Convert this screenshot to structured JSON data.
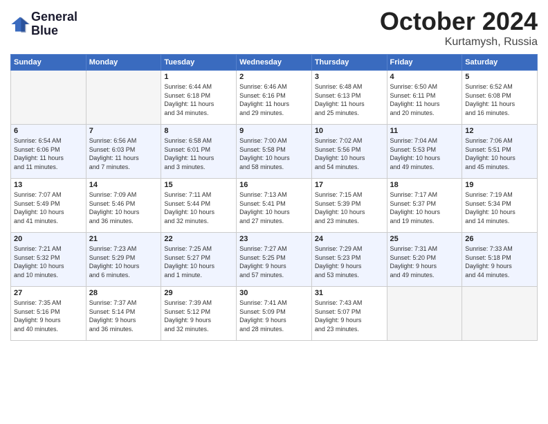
{
  "logo": {
    "line1": "General",
    "line2": "Blue"
  },
  "title": "October 2024",
  "location": "Kurtamysh, Russia",
  "weekdays": [
    "Sunday",
    "Monday",
    "Tuesday",
    "Wednesday",
    "Thursday",
    "Friday",
    "Saturday"
  ],
  "weeks": [
    [
      {
        "day": "",
        "info": ""
      },
      {
        "day": "",
        "info": ""
      },
      {
        "day": "1",
        "info": "Sunrise: 6:44 AM\nSunset: 6:18 PM\nDaylight: 11 hours\nand 34 minutes."
      },
      {
        "day": "2",
        "info": "Sunrise: 6:46 AM\nSunset: 6:16 PM\nDaylight: 11 hours\nand 29 minutes."
      },
      {
        "day": "3",
        "info": "Sunrise: 6:48 AM\nSunset: 6:13 PM\nDaylight: 11 hours\nand 25 minutes."
      },
      {
        "day": "4",
        "info": "Sunrise: 6:50 AM\nSunset: 6:11 PM\nDaylight: 11 hours\nand 20 minutes."
      },
      {
        "day": "5",
        "info": "Sunrise: 6:52 AM\nSunset: 6:08 PM\nDaylight: 11 hours\nand 16 minutes."
      }
    ],
    [
      {
        "day": "6",
        "info": "Sunrise: 6:54 AM\nSunset: 6:06 PM\nDaylight: 11 hours\nand 11 minutes."
      },
      {
        "day": "7",
        "info": "Sunrise: 6:56 AM\nSunset: 6:03 PM\nDaylight: 11 hours\nand 7 minutes."
      },
      {
        "day": "8",
        "info": "Sunrise: 6:58 AM\nSunset: 6:01 PM\nDaylight: 11 hours\nand 3 minutes."
      },
      {
        "day": "9",
        "info": "Sunrise: 7:00 AM\nSunset: 5:58 PM\nDaylight: 10 hours\nand 58 minutes."
      },
      {
        "day": "10",
        "info": "Sunrise: 7:02 AM\nSunset: 5:56 PM\nDaylight: 10 hours\nand 54 minutes."
      },
      {
        "day": "11",
        "info": "Sunrise: 7:04 AM\nSunset: 5:53 PM\nDaylight: 10 hours\nand 49 minutes."
      },
      {
        "day": "12",
        "info": "Sunrise: 7:06 AM\nSunset: 5:51 PM\nDaylight: 10 hours\nand 45 minutes."
      }
    ],
    [
      {
        "day": "13",
        "info": "Sunrise: 7:07 AM\nSunset: 5:49 PM\nDaylight: 10 hours\nand 41 minutes."
      },
      {
        "day": "14",
        "info": "Sunrise: 7:09 AM\nSunset: 5:46 PM\nDaylight: 10 hours\nand 36 minutes."
      },
      {
        "day": "15",
        "info": "Sunrise: 7:11 AM\nSunset: 5:44 PM\nDaylight: 10 hours\nand 32 minutes."
      },
      {
        "day": "16",
        "info": "Sunrise: 7:13 AM\nSunset: 5:41 PM\nDaylight: 10 hours\nand 27 minutes."
      },
      {
        "day": "17",
        "info": "Sunrise: 7:15 AM\nSunset: 5:39 PM\nDaylight: 10 hours\nand 23 minutes."
      },
      {
        "day": "18",
        "info": "Sunrise: 7:17 AM\nSunset: 5:37 PM\nDaylight: 10 hours\nand 19 minutes."
      },
      {
        "day": "19",
        "info": "Sunrise: 7:19 AM\nSunset: 5:34 PM\nDaylight: 10 hours\nand 14 minutes."
      }
    ],
    [
      {
        "day": "20",
        "info": "Sunrise: 7:21 AM\nSunset: 5:32 PM\nDaylight: 10 hours\nand 10 minutes."
      },
      {
        "day": "21",
        "info": "Sunrise: 7:23 AM\nSunset: 5:29 PM\nDaylight: 10 hours\nand 6 minutes."
      },
      {
        "day": "22",
        "info": "Sunrise: 7:25 AM\nSunset: 5:27 PM\nDaylight: 10 hours\nand 1 minute."
      },
      {
        "day": "23",
        "info": "Sunrise: 7:27 AM\nSunset: 5:25 PM\nDaylight: 9 hours\nand 57 minutes."
      },
      {
        "day": "24",
        "info": "Sunrise: 7:29 AM\nSunset: 5:23 PM\nDaylight: 9 hours\nand 53 minutes."
      },
      {
        "day": "25",
        "info": "Sunrise: 7:31 AM\nSunset: 5:20 PM\nDaylight: 9 hours\nand 49 minutes."
      },
      {
        "day": "26",
        "info": "Sunrise: 7:33 AM\nSunset: 5:18 PM\nDaylight: 9 hours\nand 44 minutes."
      }
    ],
    [
      {
        "day": "27",
        "info": "Sunrise: 7:35 AM\nSunset: 5:16 PM\nDaylight: 9 hours\nand 40 minutes."
      },
      {
        "day": "28",
        "info": "Sunrise: 7:37 AM\nSunset: 5:14 PM\nDaylight: 9 hours\nand 36 minutes."
      },
      {
        "day": "29",
        "info": "Sunrise: 7:39 AM\nSunset: 5:12 PM\nDaylight: 9 hours\nand 32 minutes."
      },
      {
        "day": "30",
        "info": "Sunrise: 7:41 AM\nSunset: 5:09 PM\nDaylight: 9 hours\nand 28 minutes."
      },
      {
        "day": "31",
        "info": "Sunrise: 7:43 AM\nSunset: 5:07 PM\nDaylight: 9 hours\nand 23 minutes."
      },
      {
        "day": "",
        "info": ""
      },
      {
        "day": "",
        "info": ""
      }
    ]
  ]
}
